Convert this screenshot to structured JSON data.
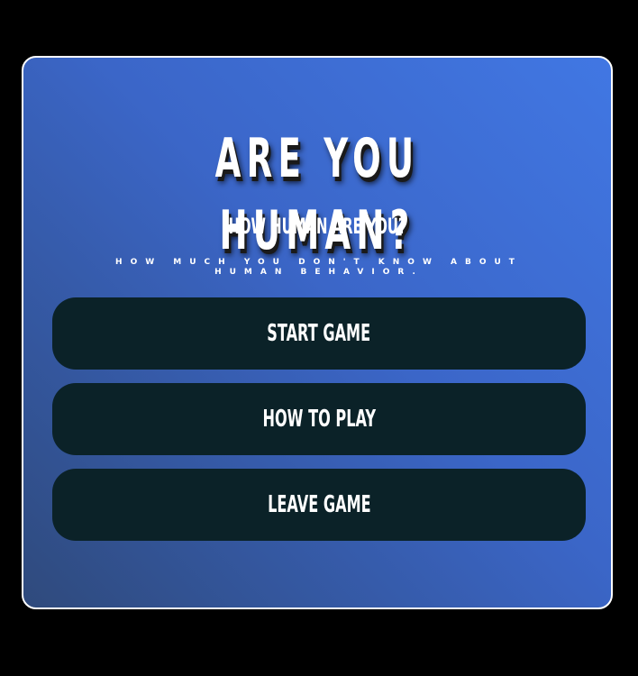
{
  "menu": {
    "title": "ARE YOU HUMAN?",
    "subtitle": "HOW HUMAN ARE YOU?",
    "tagline": "HOW MUCH YOU DON'T KNOW ABOUT HUMAN BEHAVIOR.",
    "buttons": {
      "start": "START GAME",
      "how_to_play": "HOW TO PLAY",
      "leave": "LEAVE GAME"
    }
  },
  "colors": {
    "background": "#000000",
    "card_gradient_top_right": "#4177e3",
    "card_gradient_bottom_left": "#2f4a7c",
    "card_border": "#ffffff",
    "button_background": "#0b2228",
    "text": "#ffffff"
  }
}
